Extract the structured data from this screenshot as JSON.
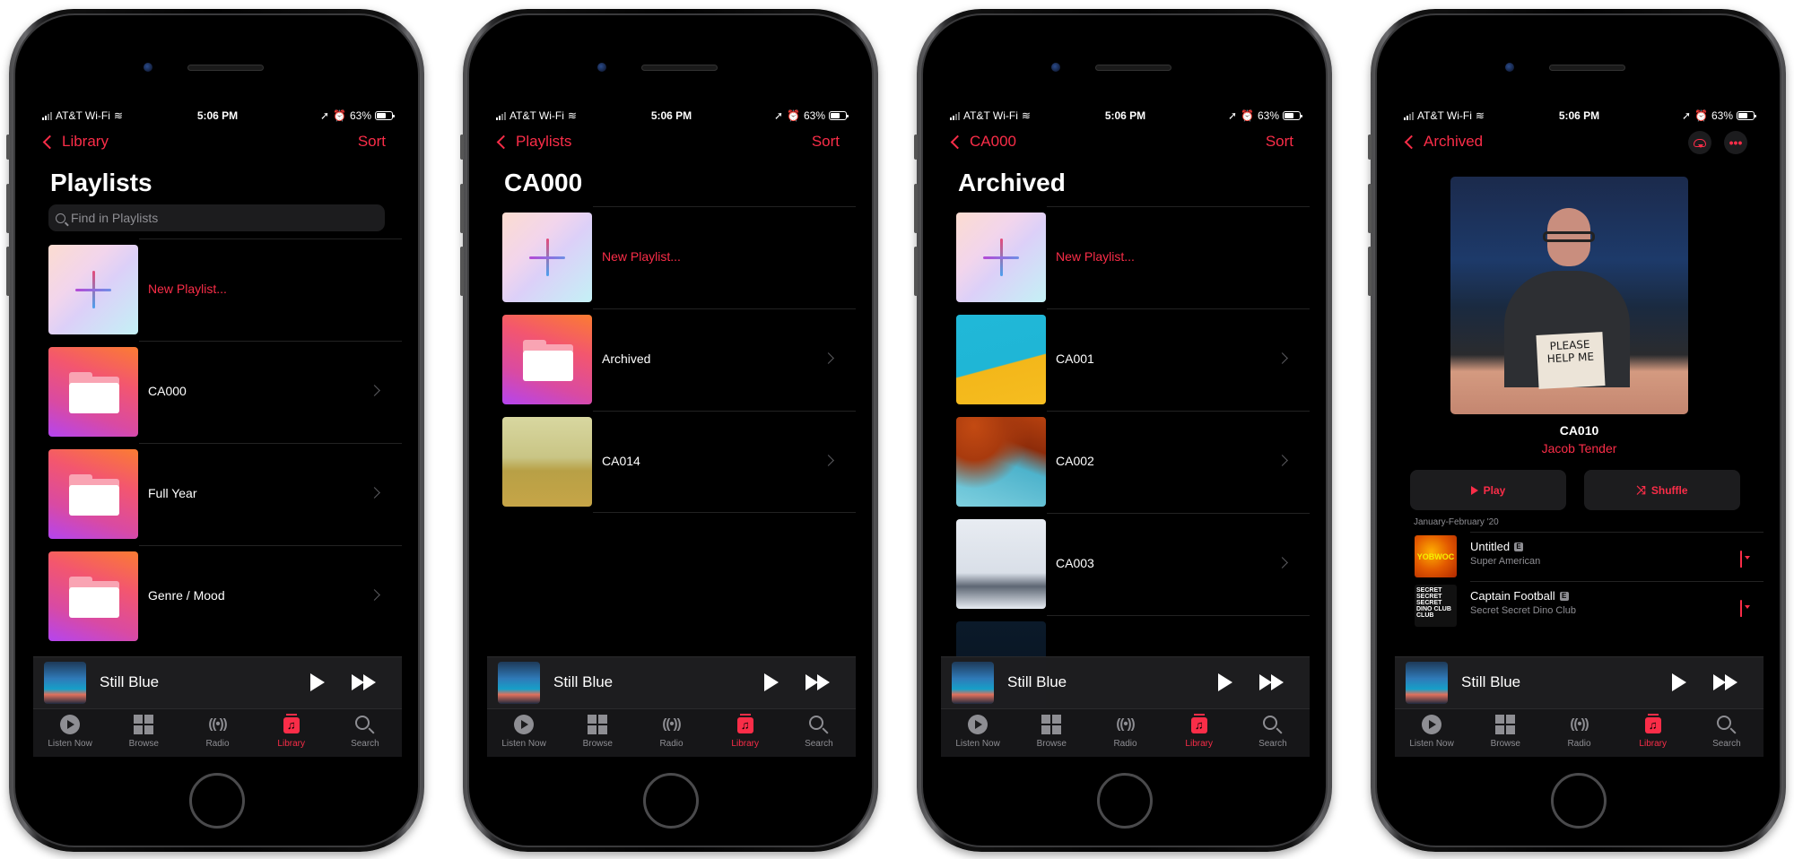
{
  "accent_color": "#fa2d48",
  "status_bar": {
    "carrier": "AT&T Wi-Fi",
    "time": "5:06 PM",
    "battery": "63%",
    "battery_level": 0.63
  },
  "now_playing": {
    "title": "Still Blue",
    "play_icon": "play-icon",
    "next_icon": "fast-forward-icon"
  },
  "tab_bar": {
    "tabs": [
      {
        "label": "Listen Now",
        "icon": "play-circle-icon"
      },
      {
        "label": "Browse",
        "icon": "grid-icon"
      },
      {
        "label": "Radio",
        "icon": "radio-waves-icon"
      },
      {
        "label": "Library",
        "icon": "music-note-icon"
      },
      {
        "label": "Search",
        "icon": "search-icon"
      }
    ],
    "active": "Library"
  },
  "screens": [
    {
      "back_label": "Library",
      "right_action": "Sort",
      "title": "Playlists",
      "search_placeholder": "Find in Playlists",
      "rows": [
        {
          "label": "New Playlist...",
          "artwork": "new-playlist",
          "accent": true
        },
        {
          "label": "CA000",
          "artwork": "folder"
        },
        {
          "label": "Full Year",
          "artwork": "folder"
        },
        {
          "label": "Genre / Mood",
          "artwork": "folder"
        }
      ]
    },
    {
      "back_label": "Playlists",
      "right_action": "Sort",
      "title": "CA000",
      "rows": [
        {
          "label": "New Playlist...",
          "artwork": "new-playlist",
          "accent": true
        },
        {
          "label": "Archived",
          "artwork": "folder"
        },
        {
          "label": "CA014",
          "artwork": "bridge-photo"
        }
      ]
    },
    {
      "back_label": "CA000",
      "right_action": "Sort",
      "title": "Archived",
      "rows": [
        {
          "label": "New Playlist...",
          "artwork": "new-playlist",
          "accent": true
        },
        {
          "label": "CA001",
          "artwork": "pool-photo"
        },
        {
          "label": "CA002",
          "artwork": "leaves-photo"
        },
        {
          "label": "CA003",
          "artwork": "mountain-photo"
        }
      ]
    },
    {
      "back_label": "Archived",
      "playlist_title": "CA010",
      "curator": "Jacob Tender",
      "artwork_sign": "PLEASE HELP ME",
      "play_label": "Play",
      "shuffle_label": "Shuffle",
      "section_label": "January-February '20",
      "explicit_badge": "E",
      "tracks": [
        {
          "title": "Untitled",
          "artist": "Super American",
          "explicit": true,
          "art_text": "YOBWOC"
        },
        {
          "title": "Captain Football",
          "artist": "Secret Secret Dino Club",
          "explicit": true,
          "art_text": "SECRET SECRET SECRET DINO CLUB CLUB"
        }
      ]
    }
  ]
}
